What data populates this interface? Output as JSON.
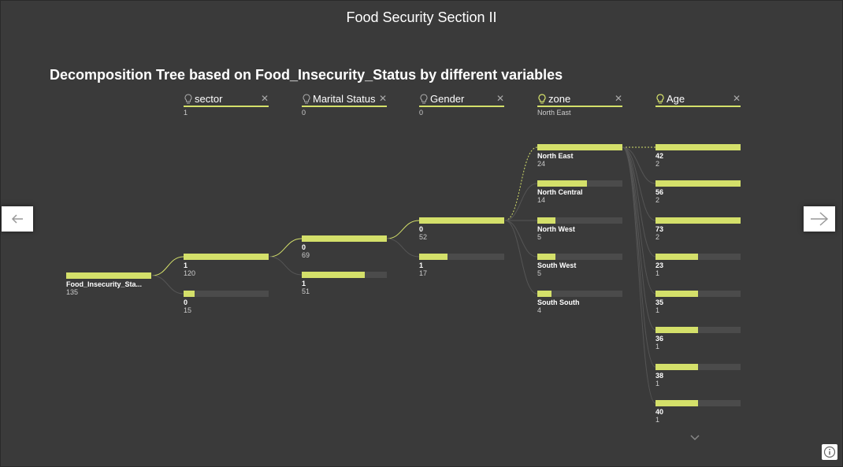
{
  "page_title": "Food Security Section II",
  "visual_title": "Decomposition Tree based on Food_Insecurity_Status by different variables",
  "columns": [
    {
      "label": "sector",
      "selected": "1",
      "icon": "lightbulb-icon"
    },
    {
      "label": "Marital Status",
      "selected": "0",
      "icon": "lightbulb-icon"
    },
    {
      "label": "Gender",
      "selected": "0",
      "icon": "lightbulb-icon"
    },
    {
      "label": "zone",
      "selected": "North East",
      "icon": "lightbulb-icon",
      "ai_split": true
    },
    {
      "label": "Age",
      "selected": "",
      "icon": "lightbulb-icon",
      "ai_split": true
    }
  ],
  "root": {
    "label": "Food_Insecurity_Sta...",
    "value": "135",
    "fill": 1.0
  },
  "tree": {
    "sector": [
      {
        "label": "1",
        "value": "120",
        "fill": 1.0
      },
      {
        "label": "0",
        "value": "15",
        "fill": 0.125
      }
    ],
    "marital": [
      {
        "label": "0",
        "value": "69",
        "fill": 1.0
      },
      {
        "label": "1",
        "value": "51",
        "fill": 0.74
      }
    ],
    "gender": [
      {
        "label": "0",
        "value": "52",
        "fill": 1.0
      },
      {
        "label": "1",
        "value": "17",
        "fill": 0.33
      }
    ],
    "zone": [
      {
        "label": "North East",
        "value": "24",
        "fill": 1.0
      },
      {
        "label": "North Central",
        "value": "14",
        "fill": 0.58
      },
      {
        "label": "North West",
        "value": "5",
        "fill": 0.21
      },
      {
        "label": "South West",
        "value": "5",
        "fill": 0.21
      },
      {
        "label": "South South",
        "value": "4",
        "fill": 0.17
      }
    ],
    "age": [
      {
        "label": "42",
        "value": "2",
        "fill": 1.0
      },
      {
        "label": "56",
        "value": "2",
        "fill": 1.0
      },
      {
        "label": "73",
        "value": "2",
        "fill": 1.0
      },
      {
        "label": "23",
        "value": "1",
        "fill": 0.5
      },
      {
        "label": "35",
        "value": "1",
        "fill": 0.5
      },
      {
        "label": "36",
        "value": "1",
        "fill": 0.5
      },
      {
        "label": "38",
        "value": "1",
        "fill": 0.5
      },
      {
        "label": "40",
        "value": "1",
        "fill": 0.5
      }
    ]
  },
  "nav": {
    "prev_icon": "arrow-left-icon",
    "next_icon": "arrow-right-icon",
    "more_icon": "chevron-down-icon",
    "info_icon": "info-icon"
  },
  "colors": {
    "accent": "#d4e06a",
    "background": "#3a3a3a",
    "bar_track": "#4b4b4b"
  }
}
